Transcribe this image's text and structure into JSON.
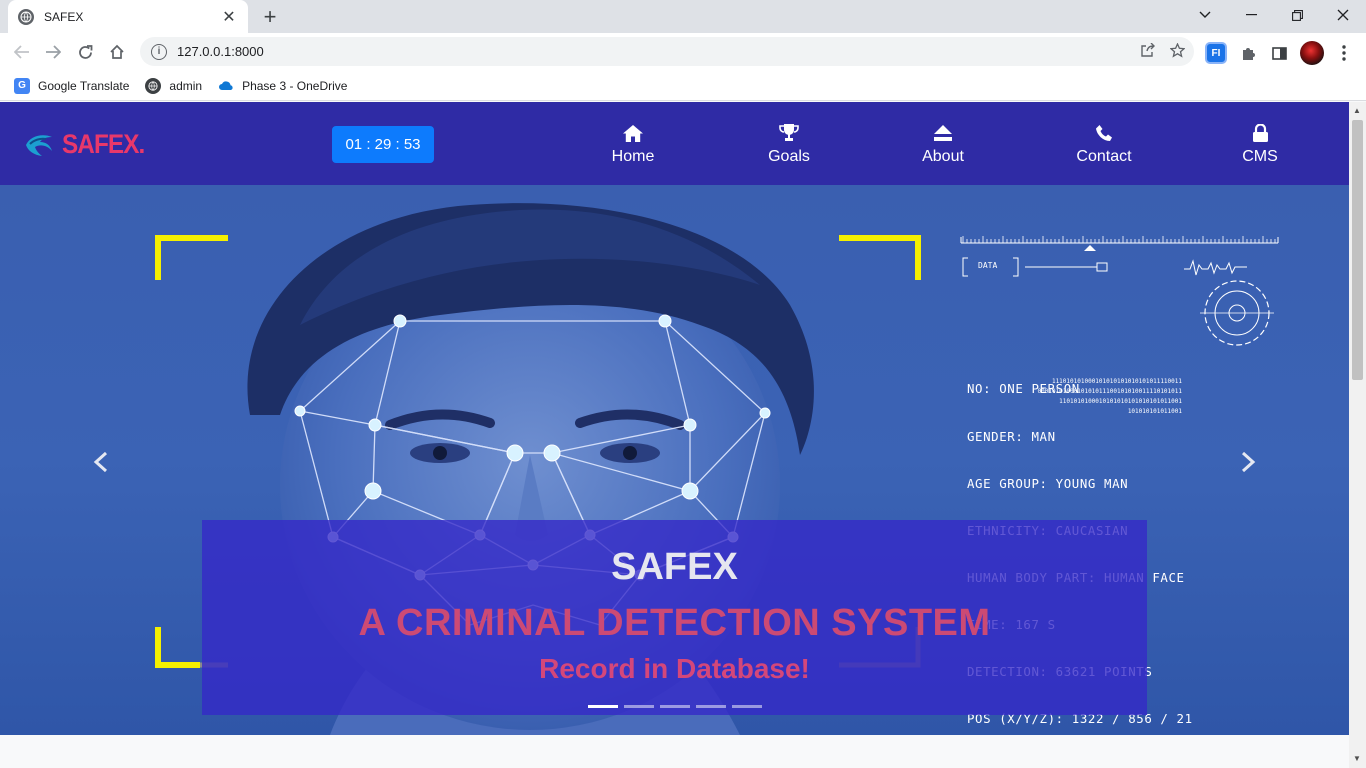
{
  "browser": {
    "tab_title": "SAFEX",
    "url": "127.0.0.1:8000",
    "bookmarks": [
      {
        "label": "Google Translate",
        "icon": "google-translate-icon"
      },
      {
        "label": "admin",
        "icon": "globe-icon"
      },
      {
        "label": "Phase 3 - OneDrive",
        "icon": "onedrive-icon"
      }
    ]
  },
  "navbar": {
    "brand": "SAFEX.",
    "timer": "01 : 29 : 53",
    "links": [
      {
        "label": "Home",
        "icon": "home-icon"
      },
      {
        "label": "Goals",
        "icon": "trophy-icon"
      },
      {
        "label": "About",
        "icon": "eject-icon"
      },
      {
        "label": "Contact",
        "icon": "phone-icon"
      },
      {
        "label": "CMS",
        "icon": "lock-icon"
      }
    ]
  },
  "hero": {
    "hud_data_label": "DATA",
    "hud_lines": [
      "NO: ONE PERSON",
      "GENDER: MAN",
      "AGE GROUP: YOUNG MAN",
      "ETHNICITY: CAUCASIAN",
      "HUMAN BODY PART: HUMAN FACE",
      "TIME: 167 S",
      "DETECTION: 63621 POINTS",
      "POS (X/Y/Z): 1322 / 856 / 21"
    ],
    "binary_lines": [
      "111010101000101010101010101011110011",
      "0001010100010101011100101010011110101011",
      "1101010100010101010101010101011001",
      "101010101011001"
    ],
    "caption_title": "SAFEX",
    "caption_subtitle": "A CRIMINAL DETECTION SYSTEM",
    "caption_text": "Record in Database!",
    "slide_count": 5,
    "active_slide": 1
  },
  "colors": {
    "navbar_bg": "#2f2ba5",
    "brand": "#e8386a",
    "timer_bg": "#0d7bfd",
    "bracket": "#f5f000"
  }
}
